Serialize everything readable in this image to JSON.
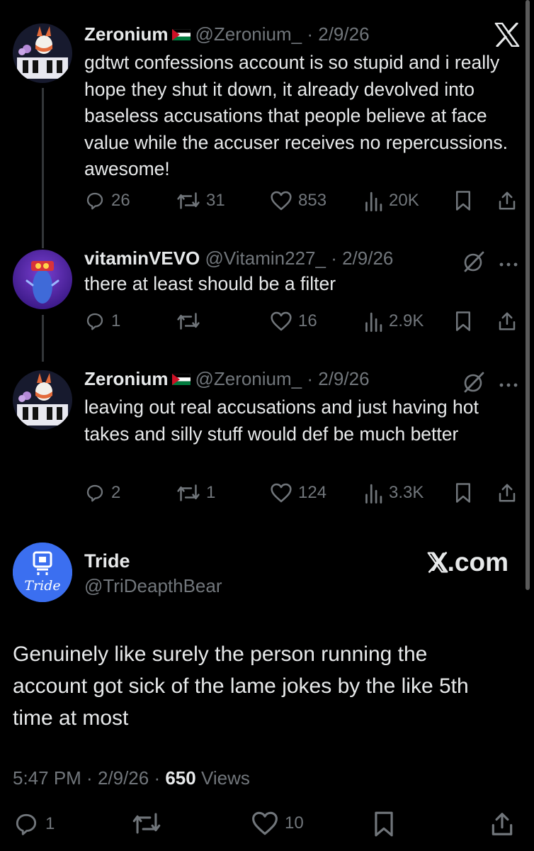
{
  "thread": [
    {
      "name": "Zeronium",
      "handle": "@Zeronium_",
      "date": "· 2/9/26",
      "text": "gdtwt confessions account is so stupid and i really hope they shut it down, it already devolved into baseless accusations that people believe at face value while the accuser receives no repercussions. awesome!",
      "replies": "26",
      "reposts": "31",
      "likes": "853",
      "views": "20K",
      "corner_icon": "x-logo-icon"
    },
    {
      "name": "vitaminVEVO",
      "handle": "@Vitamin227_",
      "date": "· 2/9/26",
      "text": "there at least should be a filter",
      "replies": "1",
      "reposts": "",
      "likes": "16",
      "views": "2.9K",
      "corner_icon": "grok-icon"
    },
    {
      "name": "Zeronium",
      "handle": "@Zeronium_",
      "date": "· 2/9/26",
      "text": "leaving out real accusations and just having hot takes and silly stuff would def be much better",
      "replies": "2",
      "reposts": "1",
      "likes": "124",
      "views": "3.3K",
      "corner_icon": "grok-icon"
    }
  ],
  "main_post": {
    "name": "Tride",
    "handle": "@TriDeapthBear",
    "avatar_text": "Tride",
    "watermark": "X.com",
    "text": "Genuinely like surely the person running the account got sick of the lame jokes by the like 5th time at most",
    "time": "5:47 PM",
    "date": "2/9/26",
    "views_count": "650",
    "views_label": "Views",
    "replies": "1",
    "likes": "10"
  },
  "colors": {
    "background": "#000000",
    "text": "#e7e9ea",
    "muted": "#71767b",
    "flag_red": "#ce1126",
    "flag_green": "#007a3d"
  }
}
